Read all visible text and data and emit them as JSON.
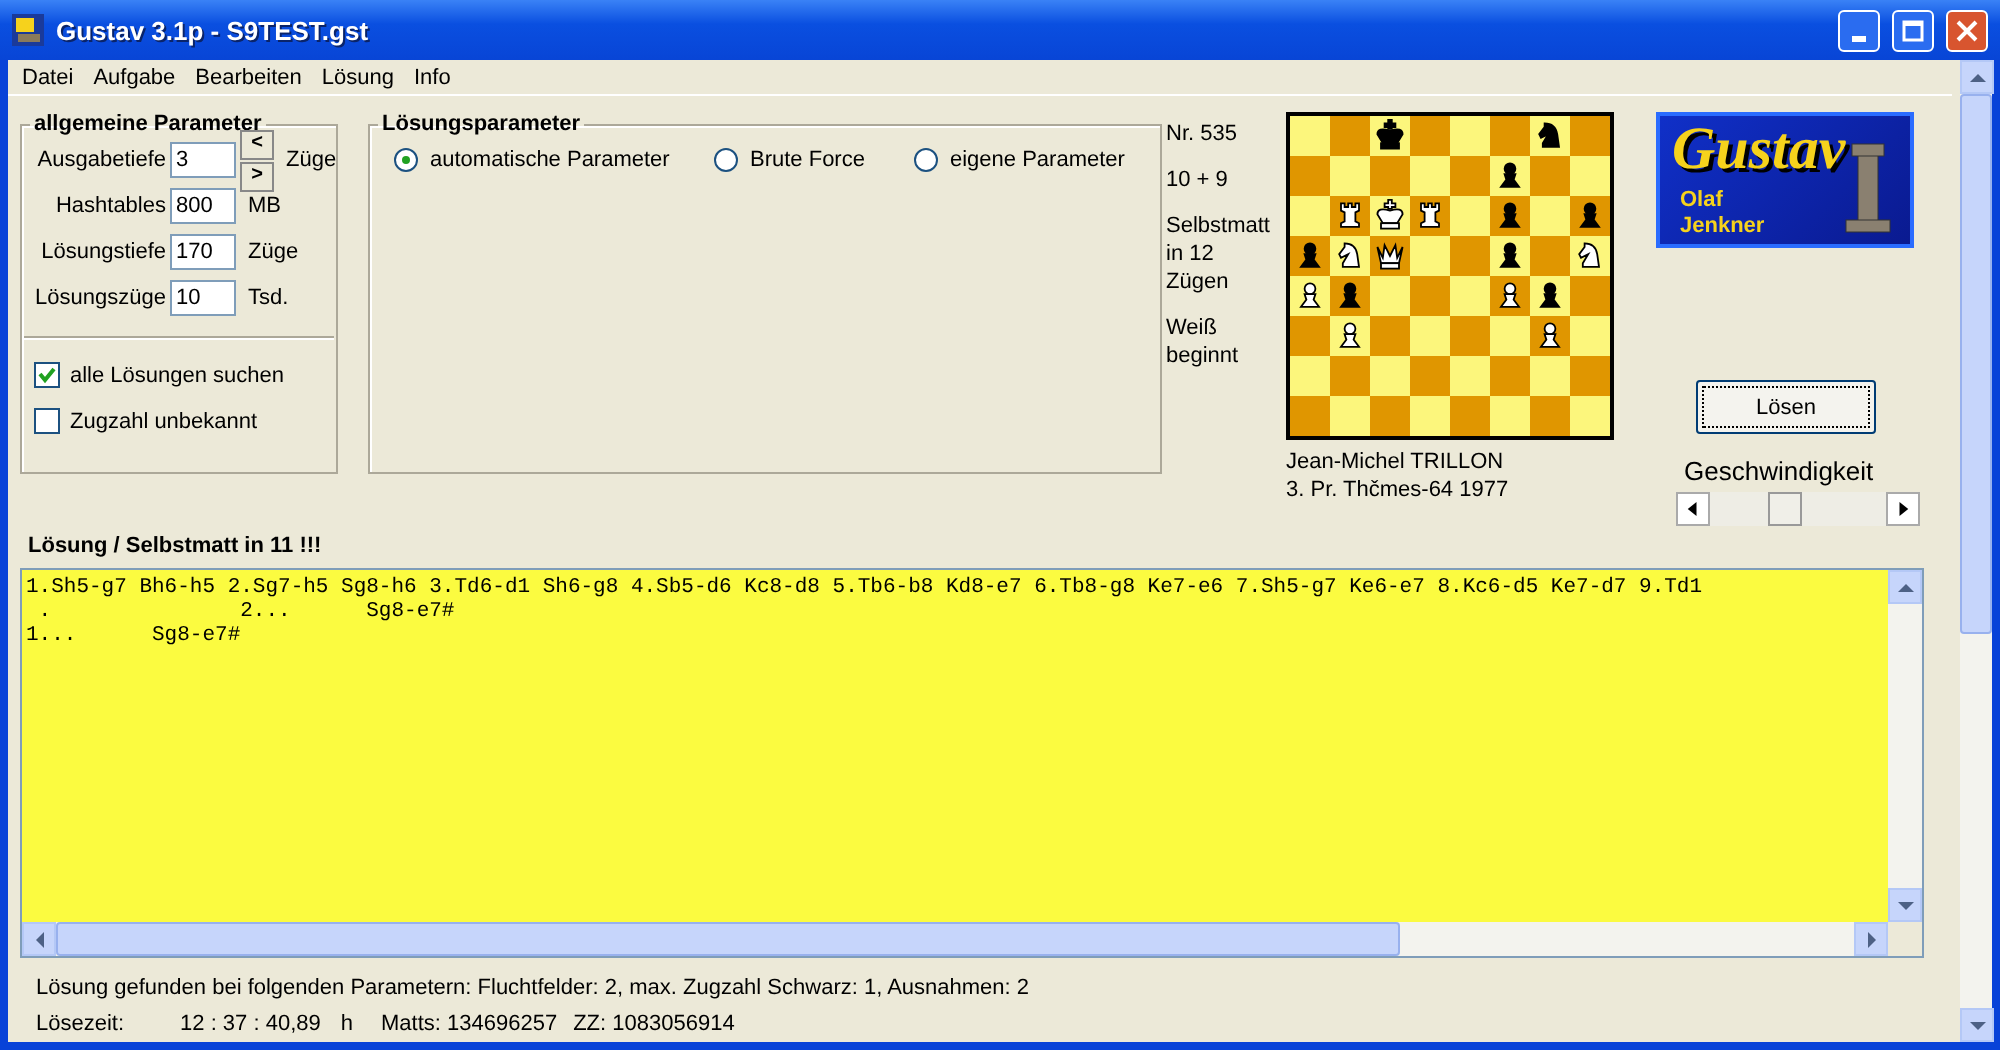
{
  "window": {
    "title": "Gustav 3.1p - S9TEST.gst"
  },
  "menu": [
    "Datei",
    "Aufgabe",
    "Bearbeiten",
    "Lösung",
    "Info"
  ],
  "general_parameters": {
    "title": "allgemeine Parameter",
    "fields": [
      {
        "label": "Ausgabetiefe",
        "value": "3",
        "unit": "Züge",
        "kind": "spinner"
      },
      {
        "label": "Hashtables",
        "value": "800",
        "unit": "MB",
        "kind": "plain"
      },
      {
        "label": "Lösungstiefe",
        "value": "170",
        "unit": "Züge",
        "kind": "plain"
      },
      {
        "label": "Lösungszüge",
        "value": "10",
        "unit": "Tsd.",
        "kind": "plain"
      }
    ],
    "spinner": {
      "up": "<",
      "down": ">"
    },
    "checkboxes": [
      {
        "label": "alle Lösungen suchen",
        "checked": true
      },
      {
        "label": "Zugzahl unbekannt",
        "checked": false
      }
    ]
  },
  "solution_parameters": {
    "title": "Lösungsparameter",
    "options": [
      {
        "label": "automatische Parameter",
        "selected": true
      },
      {
        "label": "Brute Force",
        "selected": false
      },
      {
        "label": "eigene Parameter",
        "selected": false
      }
    ]
  },
  "problem_info": [
    "Nr. 535",
    "10 + 9",
    "Selbstmatt in 12 Zügen",
    "Weiß beginnt"
  ],
  "board": {
    "rows": [
      [
        {
          "kind": "empty"
        },
        {
          "kind": "empty"
        },
        {
          "kind": "king",
          "white": false
        },
        {
          "kind": "empty"
        },
        {
          "kind": "empty"
        },
        {
          "kind": "empty"
        },
        {
          "kind": "knight",
          "white": false
        },
        {
          "kind": "empty"
        }
      ],
      [
        {
          "kind": "empty"
        },
        {
          "kind": "empty"
        },
        {
          "kind": "empty"
        },
        {
          "kind": "empty"
        },
        {
          "kind": "empty"
        },
        {
          "kind": "pawn",
          "white": false
        },
        {
          "kind": "empty"
        },
        {
          "kind": "empty"
        }
      ],
      [
        {
          "kind": "empty"
        },
        {
          "kind": "rook",
          "white": true
        },
        {
          "kind": "king",
          "white": true
        },
        {
          "kind": "rook",
          "white": true
        },
        {
          "kind": "empty"
        },
        {
          "kind": "pawn",
          "white": false
        },
        {
          "kind": "empty"
        },
        {
          "kind": "pawn",
          "white": false
        }
      ],
      [
        {
          "kind": "pawn",
          "white": false
        },
        {
          "kind": "knight",
          "white": true
        },
        {
          "kind": "queen",
          "white": true
        },
        {
          "kind": "empty"
        },
        {
          "kind": "empty"
        },
        {
          "kind": "pawn",
          "white": false
        },
        {
          "kind": "empty"
        },
        {
          "kind": "knight",
          "white": true
        }
      ],
      [
        {
          "kind": "pawn",
          "white": true
        },
        {
          "kind": "pawn",
          "white": false
        },
        {
          "kind": "empty"
        },
        {
          "kind": "empty"
        },
        {
          "kind": "empty"
        },
        {
          "kind": "pawn",
          "white": true
        },
        {
          "kind": "pawn",
          "white": false
        },
        {
          "kind": "empty"
        }
      ],
      [
        {
          "kind": "empty"
        },
        {
          "kind": "pawn",
          "white": true
        },
        {
          "kind": "empty"
        },
        {
          "kind": "empty"
        },
        {
          "kind": "empty"
        },
        {
          "kind": "empty"
        },
        {
          "kind": "pawn",
          "white": true
        },
        {
          "kind": "empty"
        }
      ],
      [
        {
          "kind": "empty"
        },
        {
          "kind": "empty"
        },
        {
          "kind": "empty"
        },
        {
          "kind": "empty"
        },
        {
          "kind": "empty"
        },
        {
          "kind": "empty"
        },
        {
          "kind": "empty"
        },
        {
          "kind": "empty"
        }
      ],
      [
        {
          "kind": "empty"
        },
        {
          "kind": "empty"
        },
        {
          "kind": "empty"
        },
        {
          "kind": "empty"
        },
        {
          "kind": "empty"
        },
        {
          "kind": "empty"
        },
        {
          "kind": "empty"
        },
        {
          "kind": "empty"
        }
      ]
    ]
  },
  "source": [
    "Jean-Michel TRILLON",
    "3. Pr. Thčmes-64 1977"
  ],
  "logo": {
    "title": "Gustav",
    "subtitle": [
      "Olaf",
      "Jenkner"
    ]
  },
  "solve_button": "Lösen",
  "speed": {
    "label": "Geschwindigkeit",
    "level": 0.42
  },
  "solution": {
    "heading": "Lösung / Selbstmatt in 11 !!!",
    "lines": [
      "1.Sh5-g7 Bh6-h5 2.Sg7-h5 Sg8-h6 3.Td6-d1 Sh6-g8 4.Sb5-d6 Kc8-d8 5.Tb6-b8 Kd8-e7 6.Tb8-g8 Ke7-e6 7.Sh5-g7 Ke6-e7 8.Kc6-d5 Ke7-d7 9.Td1",
      " .               2...      Sg8-e7#",
      "1...      Sg8-e7#"
    ]
  },
  "status": {
    "found": "Lösung gefunden bei folgenden Parametern: Fluchtfelder: 2, max. Zugzahl Schwarz: 1, Ausnahmen: 2",
    "time_label": "Lösezeit:",
    "time": "12 : 37 : 40,89",
    "unit": "h",
    "matts": "Matts: 134696257",
    "zz": "ZZ: 1083056914"
  }
}
